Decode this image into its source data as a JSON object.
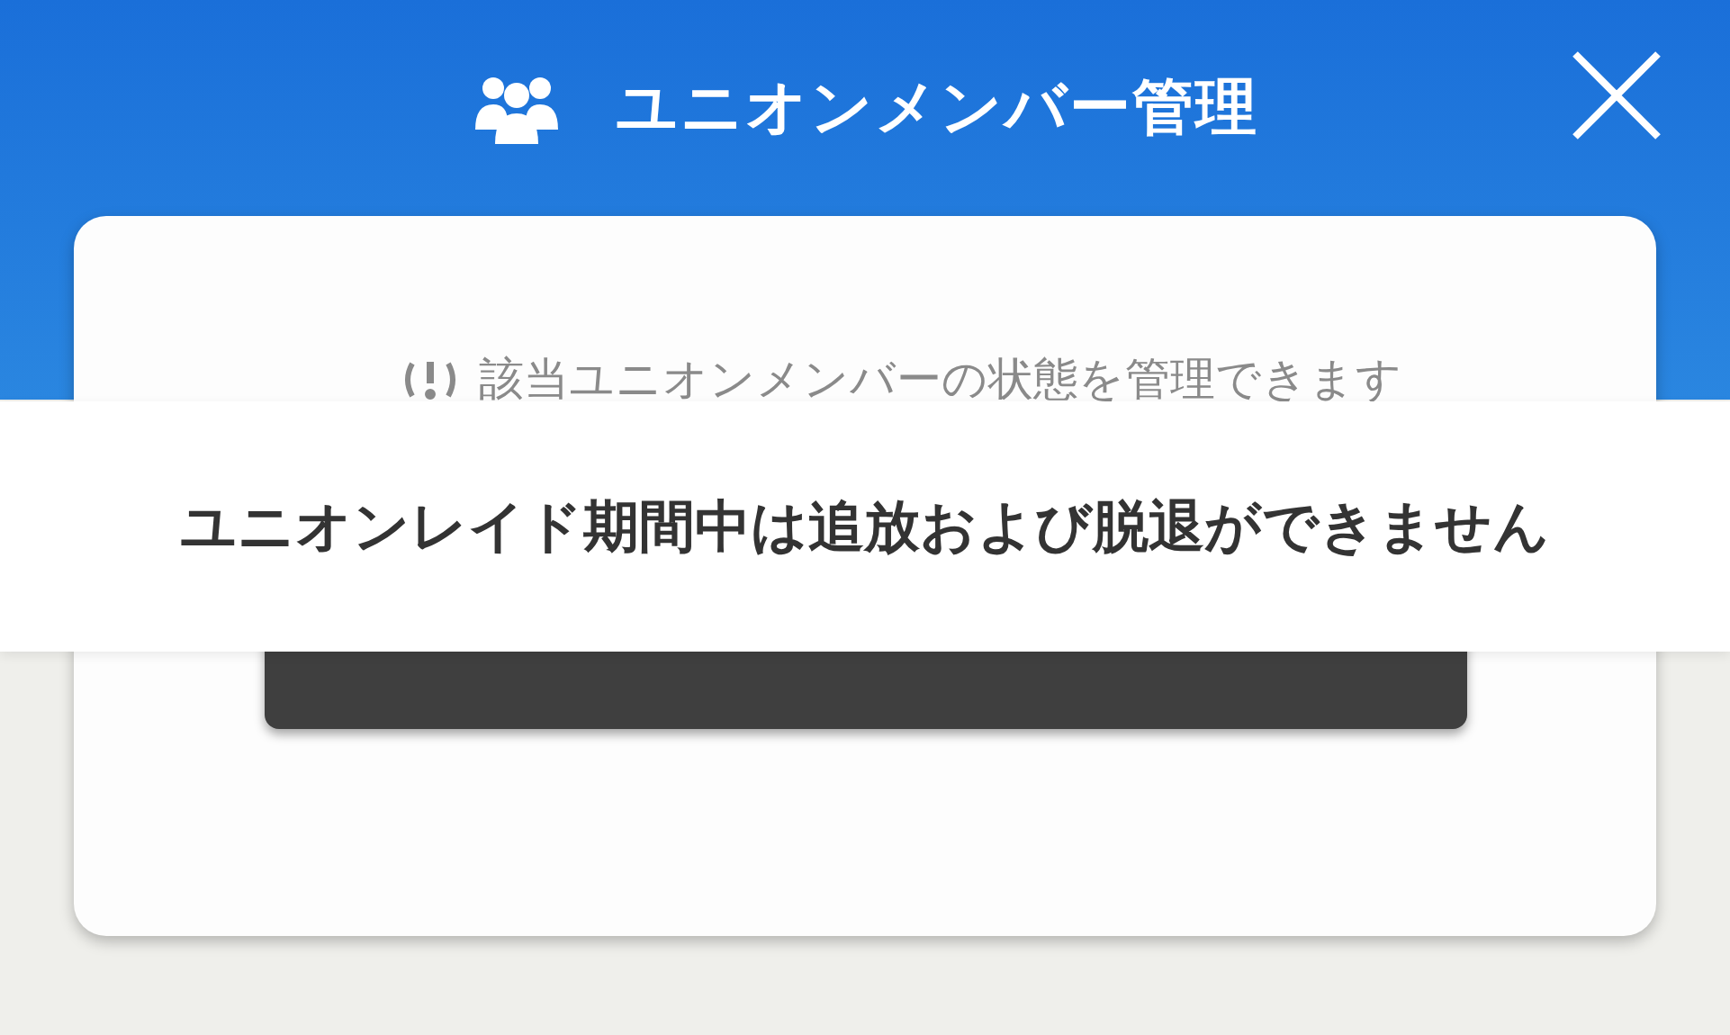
{
  "header": {
    "title": "ユニオンメンバー管理"
  },
  "info": {
    "text": "該当ユニオンメンバーの状態を管理できます"
  },
  "toast": {
    "text": "ユニオンレイド期間中は追放および脱退ができません"
  }
}
